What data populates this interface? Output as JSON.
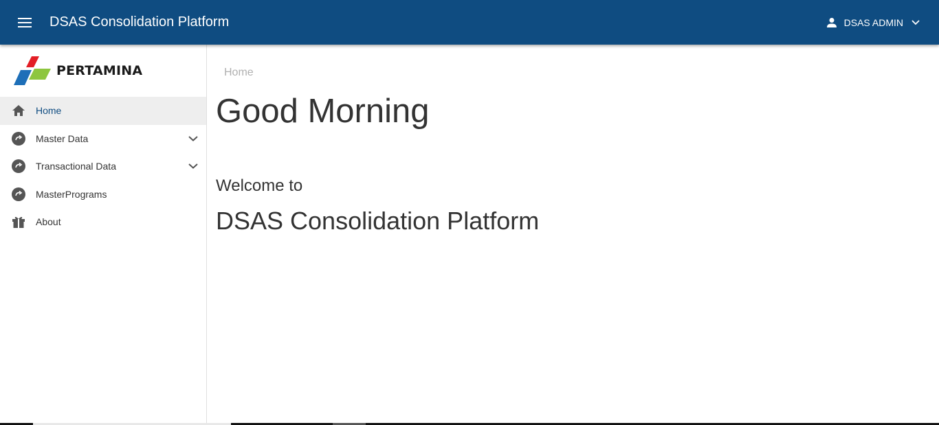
{
  "header": {
    "title": "DSAS Consolidation Platform",
    "user_name": "DSAS ADMIN",
    "menu_icon": "hamburger-icon",
    "user_icon": "person-icon",
    "dropdown_icon": "chevron-down-icon",
    "background": "#0f4c81"
  },
  "sidebar": {
    "logo_text": "PERTAMINA",
    "items": [
      {
        "label": "Home",
        "icon": "home-icon",
        "active": true,
        "expandable": false
      },
      {
        "label": "Master Data",
        "icon": "circle-arrow-icon",
        "active": false,
        "expandable": true
      },
      {
        "label": "Transactional Data",
        "icon": "circle-arrow-icon",
        "active": false,
        "expandable": true
      },
      {
        "label": "MasterPrograms",
        "icon": "circle-arrow-icon",
        "active": false,
        "expandable": false
      },
      {
        "label": "About",
        "icon": "gift-icon",
        "active": false,
        "expandable": false
      }
    ]
  },
  "main": {
    "breadcrumb": "Home",
    "greeting": "Good Morning",
    "welcome": "Welcome to",
    "platform_name": "DSAS Consolidation Platform"
  }
}
